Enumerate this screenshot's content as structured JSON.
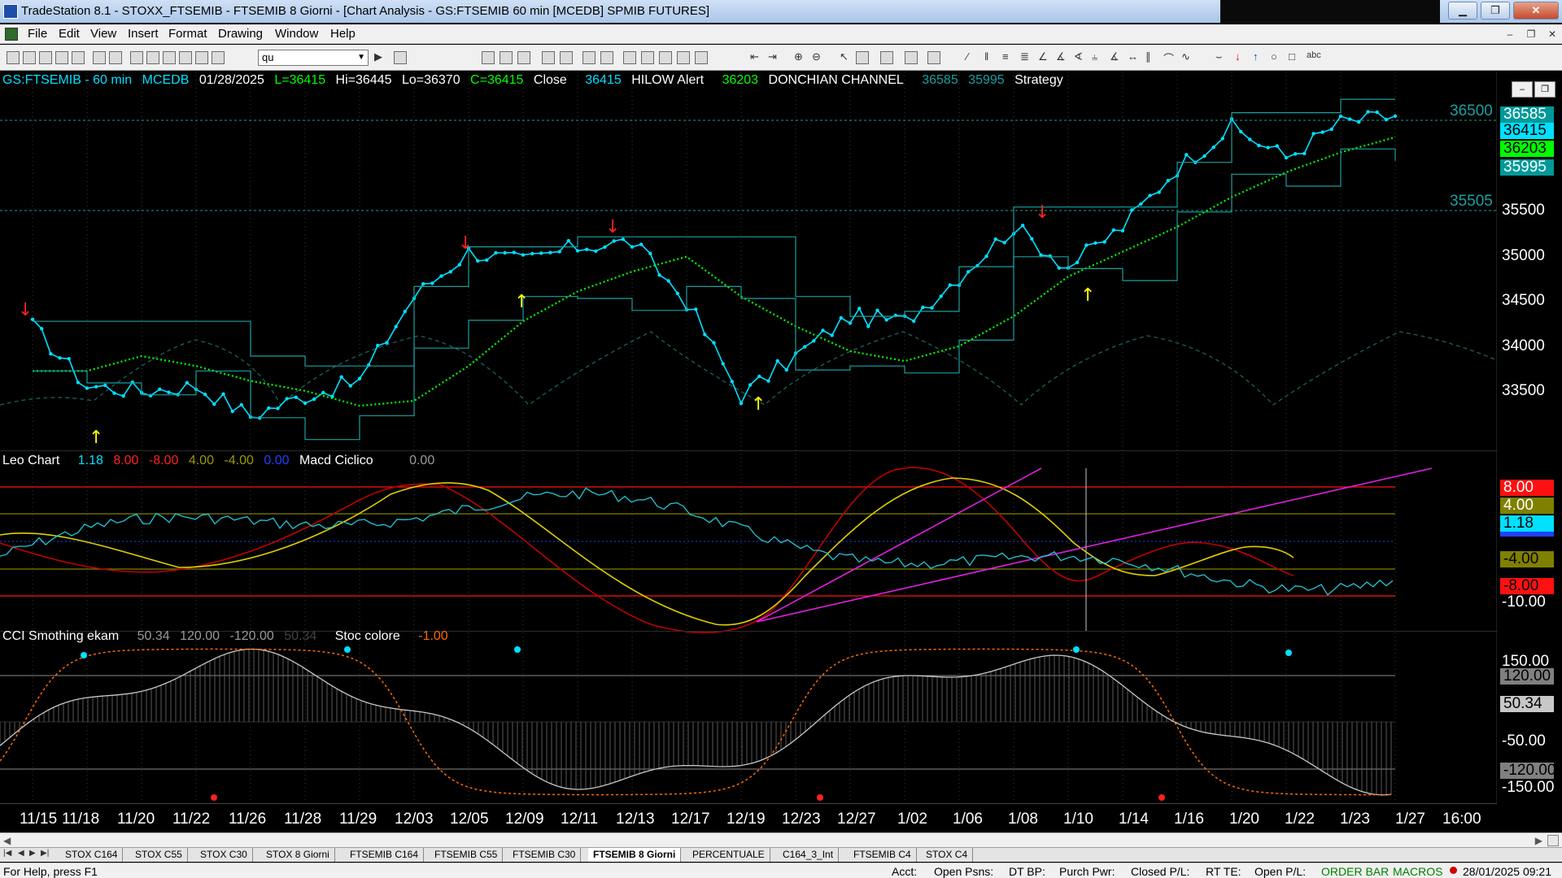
{
  "window": {
    "title": "TradeStation 8.1 - STOXX_FTSEMIB - FTSEMIB  8 Giorni - [Chart Analysis - GS:FTSEMIB  60 min  [MCEDB] SPMIB FUTURES]"
  },
  "menu": [
    "File",
    "Edit",
    "View",
    "Insert",
    "Format",
    "Drawing",
    "Window",
    "Help"
  ],
  "toolbar": {
    "symbol_value": "qu"
  },
  "price_pane": {
    "header": [
      {
        "text": "GS:FTSEMIB - 60 min",
        "color": "#00e0ff"
      },
      {
        "text": "MCEDB",
        "color": "#00e0ff"
      },
      {
        "text": "01/28/2025",
        "color": "#ffffff"
      },
      {
        "text": "L=36415",
        "color": "#00ff00"
      },
      {
        "text": "Hi=36445",
        "color": "#ffffff"
      },
      {
        "text": "Lo=36370",
        "color": "#ffffff"
      },
      {
        "text": "C=36415",
        "color": "#00ff00"
      },
      {
        "text": "Close",
        "color": "#ffffff"
      },
      {
        "text": "36415",
        "color": "#00e0ff"
      },
      {
        "text": "HILOW Alert",
        "color": "#ffffff"
      },
      {
        "text": "36203",
        "color": "#00ff00"
      },
      {
        "text": "DONCHIAN CHANNEL",
        "color": "#ffffff"
      },
      {
        "text": "36585",
        "color": "#1aa0a0"
      },
      {
        "text": "35995",
        "color": "#1aa0a0"
      },
      {
        "text": "Strategy",
        "color": "#ffffff"
      }
    ],
    "axis_ticks": [
      "35500",
      "35000",
      "34500",
      "34000",
      "33500"
    ],
    "level_labels": [
      "36500",
      "35505"
    ],
    "boxes": [
      {
        "text": "36585",
        "bg": "#009999",
        "fg": "#ffffff"
      },
      {
        "text": "36415",
        "bg": "#00e0ff",
        "fg": "#000000"
      },
      {
        "text": "36203",
        "bg": "#00ff00",
        "fg": "#000000"
      },
      {
        "text": "35995",
        "bg": "#009999",
        "fg": "#ffffff"
      }
    ]
  },
  "macd_pane": {
    "header": [
      {
        "text": "Leo Chart",
        "color": "#ffffff"
      },
      {
        "text": "1.18",
        "color": "#00e0ff"
      },
      {
        "text": "8.00",
        "color": "#ff2020"
      },
      {
        "text": "-8.00",
        "color": "#ff2020"
      },
      {
        "text": "4.00",
        "color": "#9a9a00"
      },
      {
        "text": "-4.00",
        "color": "#9a9a00"
      },
      {
        "text": "0.00",
        "color": "#2040ff"
      },
      {
        "text": "Macd Ciclico",
        "color": "#ffffff"
      },
      {
        "text": "0.00",
        "color": "#9a9a9a"
      }
    ],
    "axis_ticks": [
      "-10.00"
    ],
    "boxes": [
      {
        "text": "8.00",
        "bg": "#ff1010",
        "fg": "#ffffff"
      },
      {
        "text": "4.00",
        "bg": "#808000",
        "fg": "#ffffff"
      },
      {
        "text": "1.18",
        "bg": "#00e0ff",
        "fg": "#000000"
      },
      {
        "text": "-4.00",
        "bg": "#808000",
        "fg": "#000000"
      },
      {
        "text": "-8.00",
        "bg": "#ff1010",
        "fg": "#000000"
      }
    ]
  },
  "cci_pane": {
    "header": [
      {
        "text": "CCI Smothing ekam",
        "color": "#ffffff"
      },
      {
        "text": "50.34",
        "color": "#9a9a9a"
      },
      {
        "text": "120.00",
        "color": "#9a9a9a"
      },
      {
        "text": "-120.00",
        "color": "#9a9a9a"
      },
      {
        "text": "50.34",
        "color": "#444444"
      },
      {
        "text": "Stoc colore",
        "color": "#ffffff"
      },
      {
        "text": "-1.00",
        "color": "#ff6a00"
      }
    ],
    "axis_ticks": [
      "150.00",
      "-50.00",
      "-150.00"
    ],
    "boxes": [
      {
        "text": "120.00",
        "bg": "#808080",
        "fg": "#000000"
      },
      {
        "text": "50.34",
        "bg": "#c8c8c8",
        "fg": "#000000"
      },
      {
        "text": "-120.00",
        "bg": "#808080",
        "fg": "#000000"
      }
    ]
  },
  "x_axis": [
    "11/15",
    "11/18",
    "11/20",
    "11/22",
    "11/26",
    "11/28",
    "11/29",
    "12/03",
    "12/05",
    "12/09",
    "12/11",
    "12/13",
    "12/17",
    "12/19",
    "12/23",
    "12/27",
    "1/02",
    "1/06",
    "1/08",
    "1/10",
    "1/14",
    "1/16",
    "1/20",
    "1/22",
    "1/23",
    "1/27",
    "16:00"
  ],
  "tabs": [
    "STOX C164",
    "STOX C55",
    "STOX  C30",
    "STOX  8 Giorni",
    "FTSEMIB C164",
    "FTSEMIB C55",
    "FTSEMIB C30",
    "FTSEMIB  8 Giorni",
    "PERCENTUALE",
    "C164_3_Int",
    "FTSEMIB C4",
    "STOX  C4"
  ],
  "active_tab_index": 7,
  "status": {
    "help": "For Help, press F1",
    "acct": "Acct:",
    "open_psns": "Open Psns:",
    "dt_bp": "DT BP:",
    "purch_pwr": "Purch Pwr:",
    "closed_pl": "Closed P/L:",
    "rt_te": "RT TE:",
    "open_pl": "Open P/L:",
    "order_bar": "ORDER BAR",
    "macros": "MACROS",
    "datetime": "28/01/2025 09:21"
  },
  "chart_data": {
    "type": "line",
    "title": "GS:FTSEMIB - 60 min",
    "categories": [
      "11/15",
      "11/18",
      "11/20",
      "11/22",
      "11/26",
      "11/28",
      "11/29",
      "12/03",
      "12/05",
      "12/09",
      "12/11",
      "12/13",
      "12/17",
      "12/19",
      "12/23",
      "12/27",
      "1/02",
      "1/06",
      "1/08",
      "1/10",
      "1/14",
      "1/16",
      "1/20",
      "1/22",
      "1/23",
      "1/27"
    ],
    "series": [
      {
        "name": "Close",
        "values": [
          34300,
          33700,
          33650,
          33700,
          33400,
          33600,
          33750,
          34600,
          35050,
          34950,
          35100,
          35150,
          34550,
          33600,
          34000,
          34400,
          34350,
          34800,
          35300,
          34900,
          35300,
          35900,
          36300,
          36000,
          36350,
          36415
        ]
      },
      {
        "name": "HILOW Alert",
        "values": [
          33850,
          33850,
          34000,
          33900,
          33750,
          33650,
          33500,
          33550,
          33900,
          34350,
          34650,
          34850,
          35000,
          34600,
          34300,
          34050,
          33950,
          34100,
          34400,
          34800,
          35050,
          35300,
          35600,
          35850,
          36050,
          36203
        ]
      },
      {
        "name": "DONCHIAN CHANNEL",
        "values": [
          34350,
          34350,
          34350,
          34350,
          34000,
          33900,
          33900,
          34700,
          35100,
          35100,
          35200,
          35200,
          35200,
          35200,
          34600,
          34400,
          34450,
          34900,
          35500,
          35500,
          35500,
          35950,
          36450,
          36450,
          36585,
          36585
        ]
      }
    ],
    "ylim": [
      33100,
      36700
    ]
  }
}
